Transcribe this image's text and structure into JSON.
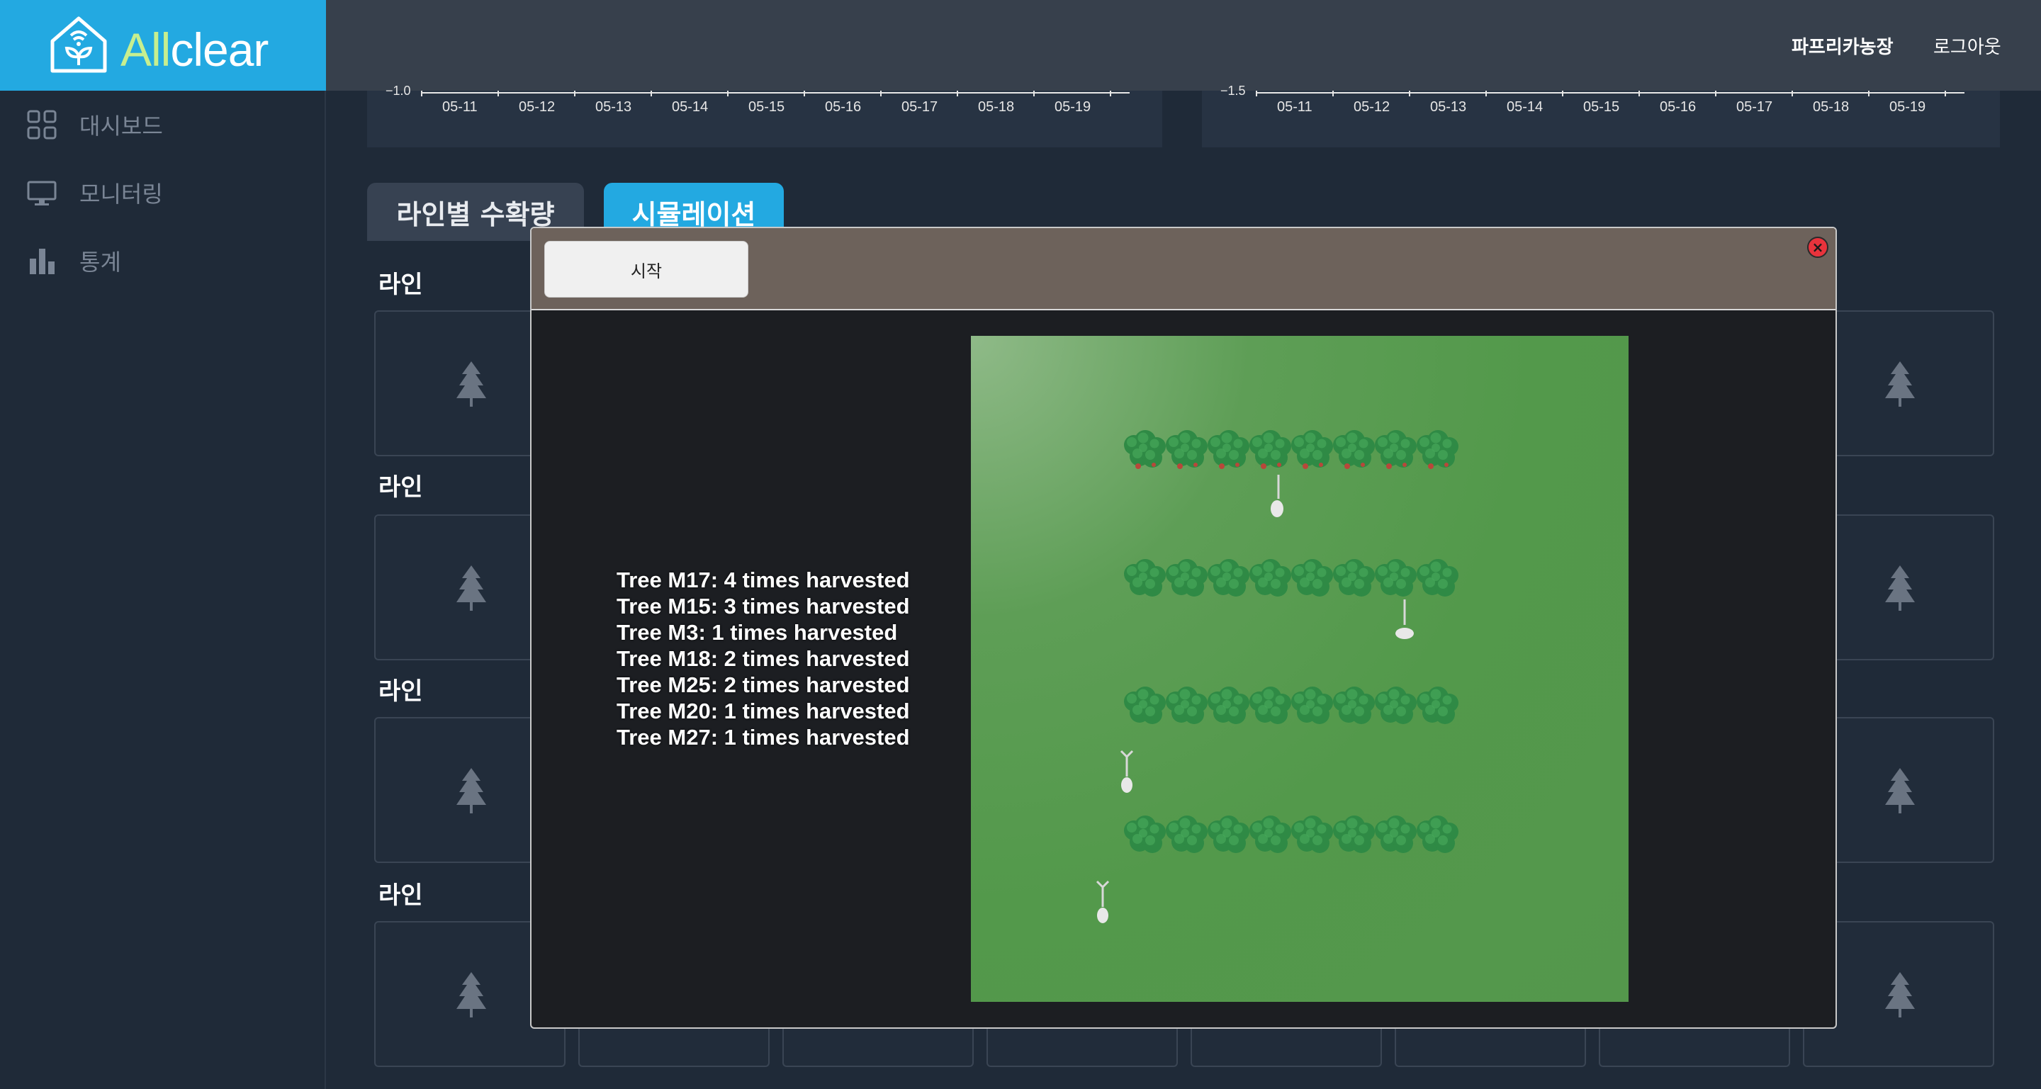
{
  "app": {
    "logo_prefix": "All",
    "logo_suffix": "clear"
  },
  "header": {
    "user_name": "파프리카농장",
    "logout_label": "로그아웃"
  },
  "sidebar": {
    "items": [
      {
        "label": "대시보드",
        "icon": "dashboard-grid-icon"
      },
      {
        "label": "모니터링",
        "icon": "monitor-icon"
      },
      {
        "label": "통계",
        "icon": "bar-chart-icon"
      }
    ]
  },
  "charts": {
    "left": {
      "y_min_label": "−1.0",
      "dates": [
        "05-11",
        "05-12",
        "05-13",
        "05-14",
        "05-15",
        "05-16",
        "05-17",
        "05-18",
        "05-19"
      ]
    },
    "right": {
      "y_min_label": "−1.5",
      "dates": [
        "05-11",
        "05-12",
        "05-13",
        "05-14",
        "05-15",
        "05-16",
        "05-17",
        "05-18",
        "05-19"
      ]
    }
  },
  "tabs": {
    "yield_label": "라인별 수확량",
    "simulation_label": "시뮬레이션"
  },
  "lines": {
    "label": "라인",
    "rows": 4,
    "cells_per_row": 8,
    "cell_icon": "tree-icon"
  },
  "modal": {
    "start_label": "시작",
    "close_icon": "close-icon",
    "harvest_log": [
      "Tree M17: 4 times harvested",
      "Tree M15: 3 times harvested",
      "Tree M3: 1 times harvested",
      "Tree M18: 2 times harvested",
      "Tree M25: 2 times harvested",
      "Tree M20: 1 times harvested",
      "Tree M27: 1 times harvested"
    ],
    "field": {
      "tree_rows": 4,
      "trees_per_row": 8,
      "robots": 4,
      "colors": {
        "grass": "#54974c",
        "tree": "#2f8a45",
        "robot": "#e8e8e8"
      }
    }
  },
  "colors": {
    "brand": "#23a9e1",
    "header_bg": "#37404c",
    "page_bg": "#1f2a38",
    "close": "#e8333c"
  }
}
